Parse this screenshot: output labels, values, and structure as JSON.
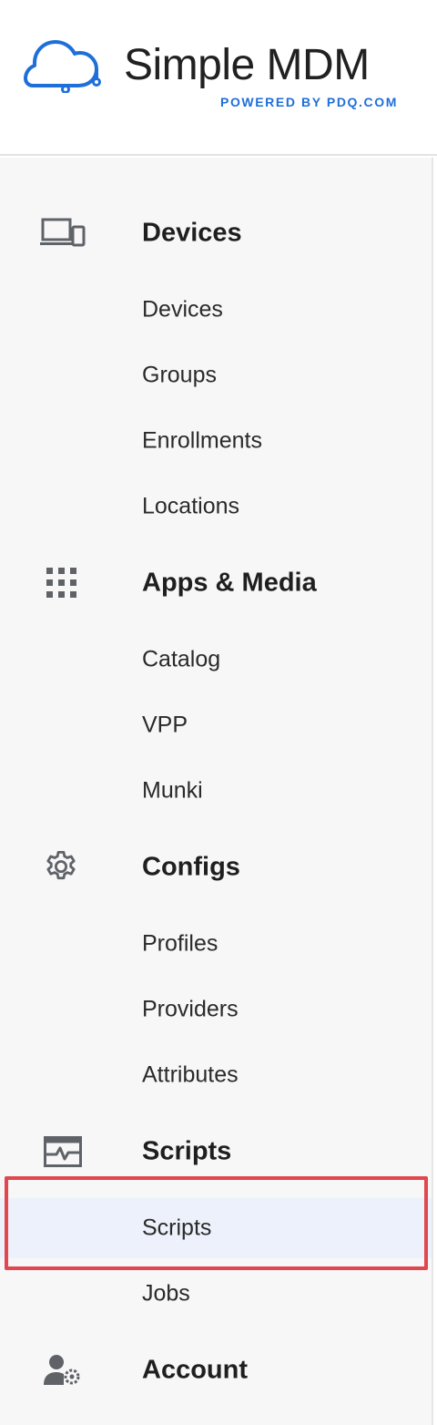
{
  "brand": {
    "name": "Simple MDM",
    "tagline": "POWERED BY PDQ.COM",
    "accent_color": "#1e6fd9"
  },
  "nav": {
    "sections": [
      {
        "label": "Devices",
        "icon": "devices-icon",
        "items": [
          "Devices",
          "Groups",
          "Enrollments",
          "Locations"
        ]
      },
      {
        "label": "Apps & Media",
        "icon": "apps-grid-icon",
        "items": [
          "Catalog",
          "VPP",
          "Munki"
        ]
      },
      {
        "label": "Configs",
        "icon": "gear-icon",
        "items": [
          "Profiles",
          "Providers",
          "Attributes"
        ]
      },
      {
        "label": "Scripts",
        "icon": "scripts-icon",
        "items": [
          "Scripts",
          "Jobs"
        ]
      },
      {
        "label": "Account",
        "icon": "account-settings-icon",
        "items": []
      }
    ],
    "active_item": "Scripts",
    "active_bg": "#ecf1fb",
    "highlight_color": "#e0474f"
  }
}
